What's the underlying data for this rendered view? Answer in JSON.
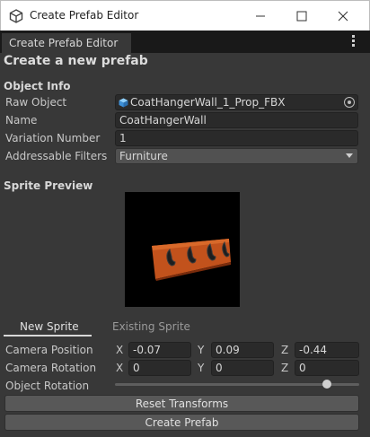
{
  "window": {
    "title": "Create Prefab Editor"
  },
  "tab": {
    "label": "Create Prefab Editor"
  },
  "heading": "Create a new prefab",
  "object_info": {
    "section": "Object Info",
    "raw_object_label": "Raw Object",
    "raw_object_value": "CoatHangerWall_1_Prop_FBX",
    "name_label": "Name",
    "name_value": "CoatHangerWall",
    "variation_label": "Variation Number",
    "variation_value": "1",
    "addressable_label": "Addressable Filters",
    "addressable_value": "Furniture"
  },
  "sprite_preview": {
    "section": "Sprite Preview"
  },
  "sprite_tabs": {
    "new": "New Sprite",
    "existing": "Existing Sprite",
    "active": "new"
  },
  "transform": {
    "camera_position_label": "Camera Position",
    "camera_rotation_label": "Camera Rotation",
    "object_rotation_label": "Object Rotation",
    "axis_x": "X",
    "axis_y": "Y",
    "axis_z": "Z",
    "camera_position": {
      "x": "-0.07",
      "y": "0.09",
      "z": "-0.44"
    },
    "camera_rotation": {
      "x": "0",
      "y": "0",
      "z": "0"
    },
    "object_rotation_fraction": 0.88
  },
  "buttons": {
    "reset": "Reset Transforms",
    "create": "Create Prefab"
  },
  "icons": {
    "app": "unity-cube-icon",
    "minimize": "minimize-icon",
    "maximize": "maximize-icon",
    "close": "close-icon",
    "menu": "kebab-menu-icon",
    "object": "mesh-cube-icon",
    "picker": "object-picker-icon",
    "dropdown": "chevron-down-icon"
  },
  "colors": {
    "background": "#383838",
    "field": "#2a2a2a",
    "button": "#585858",
    "titlebar": "#ffffff"
  }
}
